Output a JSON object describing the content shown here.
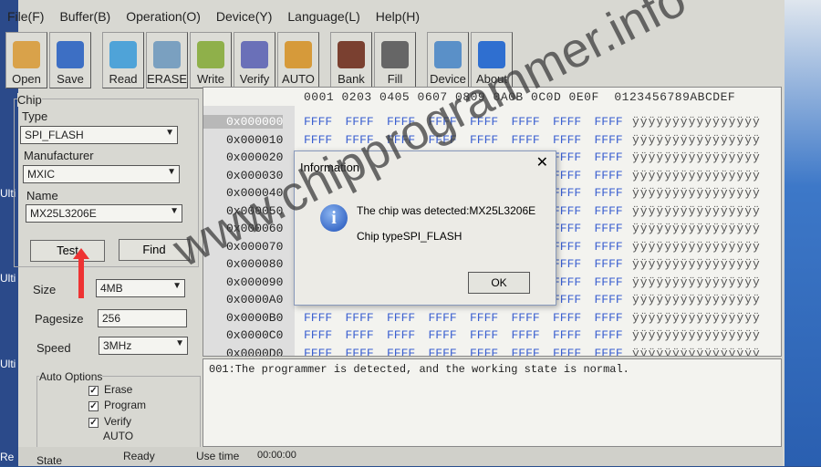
{
  "desktop": {
    "labels": [
      "Ulti",
      "Ulti",
      "Ulti",
      "Re"
    ]
  },
  "menu": [
    "File(F)",
    "Buffer(B)",
    "Operation(O)",
    "Device(Y)",
    "Language(L)",
    "Help(H)"
  ],
  "toolbar": [
    {
      "label": "Open",
      "icon": "folder-open-icon",
      "color": "#d9a24a"
    },
    {
      "label": "Save",
      "icon": "floppy-disk-icon",
      "color": "#3d6fc4"
    },
    {
      "label": "Read",
      "icon": "notepad-icon",
      "color": "#4fa3d8"
    },
    {
      "label": "ERASE",
      "icon": "trash-can-icon",
      "color": "#7aa0c0"
    },
    {
      "label": "Write",
      "icon": "folder-down-arrow-icon",
      "color": "#8fb04a"
    },
    {
      "label": "Verify",
      "icon": "magnifier-chip-icon",
      "color": "#6a70b8"
    },
    {
      "label": "AUTO",
      "icon": "running-man-icon",
      "color": "#d69a3a"
    },
    {
      "label": "Bank",
      "icon": "chip-info-icon",
      "color": "#7a4030"
    },
    {
      "label": "Fill",
      "icon": "bucket-icon",
      "color": "#666666"
    },
    {
      "label": "Device",
      "icon": "gear-icon",
      "color": "#5a90c8"
    },
    {
      "label": "About",
      "icon": "help-icon",
      "color": "#2f6fd0"
    }
  ],
  "chip": {
    "group": "Chip",
    "type_label": "Type",
    "type": "SPI_FLASH",
    "manufacturer_label": "Manufacturer",
    "manufacturer": "MXIC",
    "name_label": "Name",
    "name": "MX25L3206E",
    "test": "Test",
    "find": "Find"
  },
  "params": {
    "size_label": "Size",
    "size": "4MB",
    "pagesize_label": "Pagesize",
    "pagesize": "256",
    "speed_label": "Speed",
    "speed": "3MHz"
  },
  "auto_options": {
    "label": "Auto Options",
    "items": [
      {
        "label": "Erase",
        "checked": true
      },
      {
        "label": "Program",
        "checked": true
      },
      {
        "label": "Verify",
        "checked": true
      }
    ],
    "auto": "AUTO"
  },
  "hex": {
    "header": "0001 0203 0405 0607 0809 0A0B 0C0D 0E0F  0123456789ABCDEF",
    "addresses": [
      "0x000000",
      "0x000010",
      "0x000020",
      "0x000030",
      "0x000040",
      "0x000050",
      "0x000060",
      "0x000070",
      "0x000080",
      "0x000090",
      "0x0000A0",
      "0x0000B0",
      "0x0000C0",
      "0x0000D0"
    ],
    "word": "FFFF",
    "ascii": "ÿÿÿÿÿÿÿÿÿÿÿÿÿÿÿÿ"
  },
  "log": "001:The programmer is detected, and the working state is normal.",
  "status": {
    "state": "State",
    "ready": "Ready",
    "use_time_label": "Use time",
    "use_time": "00:00:00"
  },
  "dialog": {
    "title": "Information",
    "message": "The chip was detected:MX25L3206E",
    "chip_type": "Chip typeSPI_FLASH",
    "ok": "OK"
  },
  "watermark": "www.chipprogrammer.info"
}
